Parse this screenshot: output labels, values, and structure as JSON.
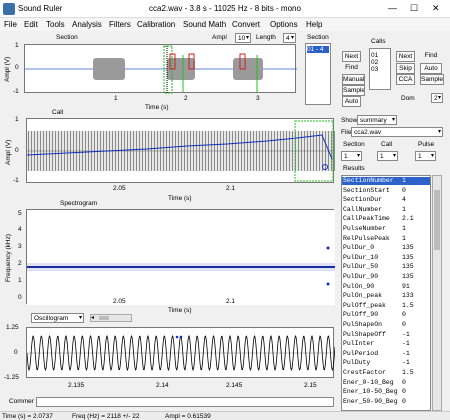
{
  "window": {
    "app_name": "Sound Ruler",
    "title": "cca2.wav - 3.8 s - 11025 Hz - 8 bits - mono",
    "min": "—",
    "max": "☐",
    "close": "✕"
  },
  "menu": [
    "File",
    "Edit",
    "Tools",
    "Analysis",
    "Filters",
    "Calibration",
    "Sound Math",
    "Convert",
    "Options",
    "Help"
  ],
  "section_panel": {
    "title": "Section",
    "ampl_label": "Ampl",
    "ampl_value": "10",
    "length_label": "Length",
    "length_value": "4",
    "ylabel": "Ampl (V)",
    "xlabel": "Time (s)",
    "xticks": [
      "1",
      "2",
      "3"
    ],
    "yticks": [
      "1",
      "0",
      "-1"
    ]
  },
  "section_buttons": {
    "next": "Next",
    "find": "Find",
    "manual": "Manual",
    "sample": "Sample",
    "auto": "Auto"
  },
  "section_list": {
    "title": "Section",
    "items": [
      "01 - 4"
    ]
  },
  "calls": {
    "title": "Calls",
    "items": [
      "01",
      "02",
      "03"
    ],
    "next": "Next",
    "skip": "Skip",
    "cca": "CCA",
    "find": "Find",
    "auto": "Auto",
    "sample": "Sample",
    "dom_label": "Dom",
    "dom_value": "2"
  },
  "call_panel": {
    "title": "Call",
    "ylabel": "Ampl (V)",
    "xlabel": "Time (s)",
    "xticks": [
      "2.05",
      "2.1"
    ],
    "yticks": [
      "1",
      "0",
      "-1"
    ]
  },
  "show": {
    "label": "Show",
    "value": "summary"
  },
  "file": {
    "label": "File",
    "value": "cca2.wav"
  },
  "selectors": {
    "section_label": "Section",
    "section_value": "1",
    "call_label": "Call",
    "call_value": "1",
    "pulse_label": "Pulse",
    "pulse_value": "1"
  },
  "results": {
    "title": "Results",
    "rows": [
      {
        "k": "SectionNumber",
        "v": "1"
      },
      {
        "k": "SectionStart",
        "v": "0"
      },
      {
        "k": "SectionDur",
        "v": "4"
      },
      {
        "k": "CallNumber",
        "v": "1"
      },
      {
        "k": "CallPeakTime",
        "v": "2.1"
      },
      {
        "k": "PulseNumber",
        "v": "1"
      },
      {
        "k": "RelPulsePeak",
        "v": "1"
      },
      {
        "k": "PulDur_0",
        "v": "135"
      },
      {
        "k": "PulDur_10",
        "v": "135"
      },
      {
        "k": "PulDur_50",
        "v": "135"
      },
      {
        "k": "PulDur_90",
        "v": "135"
      },
      {
        "k": "PulOn_90",
        "v": "91"
      },
      {
        "k": "PulOn_peak",
        "v": "133"
      },
      {
        "k": "PulOff_peak",
        "v": "1.5"
      },
      {
        "k": "PulOff_90",
        "v": "0"
      },
      {
        "k": "PulShapeOn",
        "v": "0"
      },
      {
        "k": "PulShapeOff",
        "v": "-1"
      },
      {
        "k": "PulInter",
        "v": "-1"
      },
      {
        "k": "PulPeriod",
        "v": "-1"
      },
      {
        "k": "PulDuty",
        "v": "-1"
      },
      {
        "k": "CrestFactor",
        "v": "1.5"
      },
      {
        "k": "Ener_0-10_Beg",
        "v": "0"
      },
      {
        "k": "Ener_10-50_Beg",
        "v": "0"
      },
      {
        "k": "Ener_50-90_Beg",
        "v": "0"
      }
    ]
  },
  "spectro_panel": {
    "title": "Spectrogram",
    "ylabel": "Frequency (kHz)",
    "xlabel": "Time (s)",
    "xticks": [
      "2.05",
      "2.1"
    ],
    "yticks": [
      "5",
      "4",
      "3",
      "2",
      "1",
      "0"
    ]
  },
  "oscillo_panel": {
    "dropdown": "Oscillogram",
    "xticks": [
      "2.135",
      "2.14",
      "2.145",
      "2.15"
    ],
    "yticks": [
      "1.25",
      "0",
      "-1.25"
    ]
  },
  "comment_label": "Commer",
  "status": {
    "time": "Time (s) = 2.0737",
    "freq": "Freq (Hz) = 2118 +/- 22",
    "ampl": "Ampl = 0.61539"
  }
}
